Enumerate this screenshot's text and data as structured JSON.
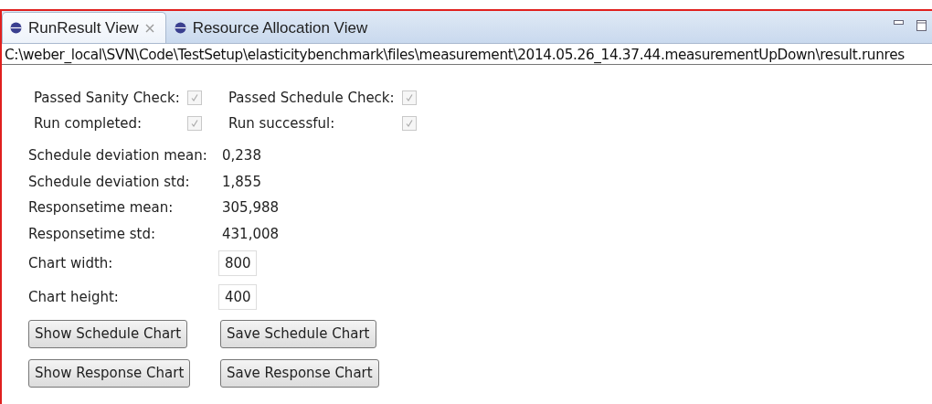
{
  "tabs": [
    {
      "label": "RunResult View",
      "selected": true,
      "closable": true
    },
    {
      "label": "Resource Allocation View",
      "selected": false,
      "closable": false
    }
  ],
  "path": "C:\\weber_local\\SVN\\Code\\TestSetup\\elasticitybenchmark\\files\\measurement\\2014.05.26_14.37.44.measurementUpDown\\result.runres",
  "checks": [
    {
      "label": "Passed Sanity Check:",
      "checked": true,
      "disabled": true
    },
    {
      "label": "Passed Schedule Check:",
      "checked": true,
      "disabled": true
    },
    {
      "label": "Run completed:",
      "checked": true,
      "disabled": true
    },
    {
      "label": "Run successful:",
      "checked": true,
      "disabled": true
    }
  ],
  "stats": [
    {
      "label": "Schedule deviation mean:",
      "value": "0,238"
    },
    {
      "label": "Schedule deviation std:",
      "value": "1,855"
    },
    {
      "label": "Responsetime mean:",
      "value": "305,988"
    },
    {
      "label": "Responsetime std:",
      "value": "431,008"
    }
  ],
  "fields": [
    {
      "label": "Chart width:",
      "value": "800"
    },
    {
      "label": "Chart height:",
      "value": "400"
    }
  ],
  "buttons": [
    [
      "Show Schedule Chart",
      "Save Schedule Chart"
    ],
    [
      "Show Response Chart",
      "Save Response Chart"
    ]
  ]
}
